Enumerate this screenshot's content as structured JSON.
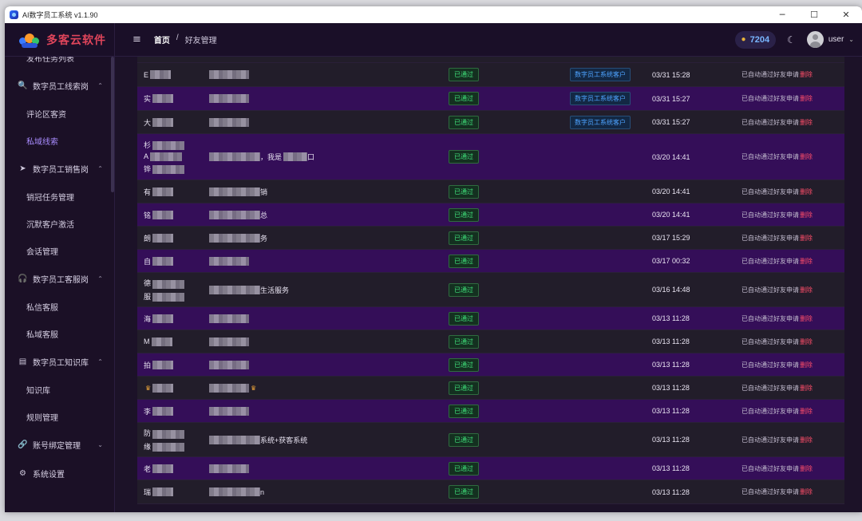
{
  "window": {
    "title": "AI数字员工系统 v1.1.90",
    "minimize": "─",
    "maximize": "☐",
    "close": "✕"
  },
  "header": {
    "brand": "多客云软件",
    "menu_icon": "≡",
    "breadcrumb": {
      "home": "首页",
      "sep": "/",
      "current": "好友管理"
    },
    "coins": "7204",
    "user": "user"
  },
  "sidebar": {
    "items": [
      {
        "type": "item",
        "label": "发布任务列表",
        "icon": ""
      },
      {
        "type": "group",
        "label": "数字员工线索岗",
        "icon": "🔍",
        "chev": "^"
      },
      {
        "type": "item",
        "label": "评论区客资"
      },
      {
        "type": "item",
        "label": "私域线索",
        "active": true
      },
      {
        "type": "group",
        "label": "数字员工销售岗",
        "icon": "➤",
        "chev": "^"
      },
      {
        "type": "item",
        "label": "销冠任务管理"
      },
      {
        "type": "item",
        "label": "沉默客户激活"
      },
      {
        "type": "item",
        "label": "会话管理"
      },
      {
        "type": "group",
        "label": "数字员工客服岗",
        "icon": "🎧",
        "chev": "^"
      },
      {
        "type": "item",
        "label": "私信客服"
      },
      {
        "type": "item",
        "label": "私域客服"
      },
      {
        "type": "group",
        "label": "数字员工知识库",
        "icon": "▤",
        "chev": "^"
      },
      {
        "type": "item",
        "label": "知识库"
      },
      {
        "type": "item",
        "label": "规则管理"
      },
      {
        "type": "group",
        "label": "账号绑定管理",
        "icon": "🔗",
        "chev": "v"
      },
      {
        "type": "group",
        "label": "系统设置",
        "icon": "⚙",
        "chev": ""
      }
    ]
  },
  "table": {
    "status_label": "已通过",
    "tag_label": "数字员工系统客户",
    "action_text": "已自动通过好友申请",
    "delete_label": "删除",
    "rows": [
      {
        "name": "",
        "remark": "",
        "tag": false,
        "time": "",
        "height": 24,
        "style": "dark"
      },
      {
        "name": "E",
        "remark": "",
        "tag": true,
        "time": "03/31 15:28",
        "height": 30,
        "style": "dark"
      },
      {
        "name": "实",
        "remark": "",
        "tag": true,
        "time": "03/31 15:27",
        "height": 30,
        "style": "purple"
      },
      {
        "name": "大",
        "remark": "",
        "tag": true,
        "time": "03/31 15:27",
        "height": 29,
        "style": "dark"
      },
      {
        "name": "杉\nA\n铧",
        "remark": "，我是",
        "remark_tail": "口",
        "tag": false,
        "time": "03/20 14:41",
        "height": 58,
        "style": "purple"
      },
      {
        "name": "有",
        "remark": "",
        "remark_tail": "销",
        "tag": false,
        "time": "03/20 14:41",
        "height": 29,
        "style": "dark"
      },
      {
        "name": "铭",
        "remark": "",
        "remark_tail": "总",
        "tag": false,
        "time": "03/20 14:41",
        "height": 29,
        "style": "purple"
      },
      {
        "name": "朗",
        "remark": "",
        "remark_tail": "务",
        "tag": false,
        "time": "03/17 15:29",
        "height": 29,
        "style": "dark"
      },
      {
        "name": "自",
        "remark": "",
        "tag": false,
        "time": "03/17 00:32",
        "height": 29,
        "style": "purple"
      },
      {
        "name": "德\n服",
        "remark": "",
        "remark_tail": "生活服务",
        "tag": false,
        "time": "03/16 14:48",
        "height": 43,
        "style": "dark"
      },
      {
        "name": "海",
        "remark": "",
        "tag": false,
        "time": "03/13 11:28",
        "height": 29,
        "style": "purple"
      },
      {
        "name": "M",
        "remark": "",
        "tag": false,
        "time": "03/13 11:28",
        "height": 29,
        "style": "dark"
      },
      {
        "name": "拍",
        "remark": "",
        "tag": false,
        "time": "03/13 11:28",
        "height": 29,
        "style": "purple"
      },
      {
        "name": "",
        "remark": "",
        "crown": true,
        "tag": false,
        "time": "03/13 11:28",
        "height": 29,
        "style": "dark"
      },
      {
        "name": "李",
        "remark": "",
        "tag": false,
        "time": "03/13 11:28",
        "height": 29,
        "style": "purple"
      },
      {
        "name": "防\n缘",
        "remark": "",
        "remark_tail": "系统+获客系统",
        "tag": false,
        "time": "03/13 11:28",
        "height": 43,
        "style": "dark"
      },
      {
        "name": "老",
        "remark": "",
        "tag": false,
        "time": "03/13 11:28",
        "height": 29,
        "style": "purple"
      },
      {
        "name": "瑞",
        "remark": "",
        "remark_tail": "n",
        "tag": false,
        "time": "03/13 11:28",
        "height": 30,
        "style": "dark"
      }
    ]
  }
}
